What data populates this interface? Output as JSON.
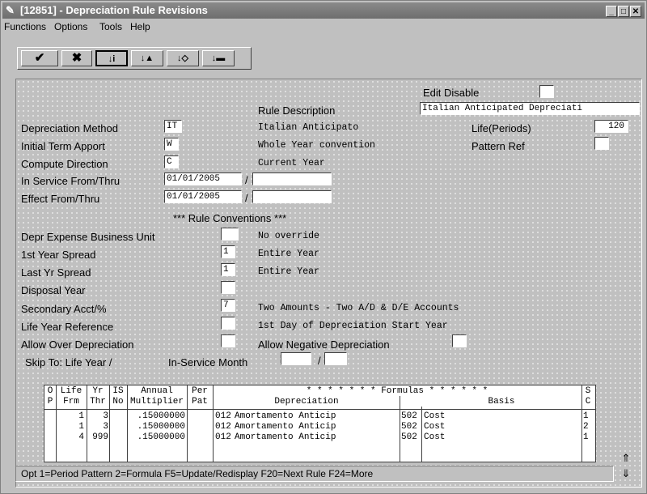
{
  "window": {
    "title": "[12851] - Depreciation Rule Revisions",
    "icon": "app-icon",
    "controls": [
      "_",
      "□",
      "✕"
    ]
  },
  "menu": [
    "Functions",
    "Options",
    "Tools",
    "Help"
  ],
  "toolbar": {
    "icons": [
      "ok-check-icon",
      "cancel-x-icon",
      "inquire-icon",
      "add-icon",
      "change-icon",
      "delete-icon"
    ]
  },
  "header": {
    "edit_disable_label": "Edit Disable",
    "edit_disable_value": "",
    "rule_description_label": "Rule Description",
    "rule_description_value": "Italian Anticipated Depreciati"
  },
  "fields": {
    "depr_method_label": "Depreciation Method",
    "depr_method_value": "IT",
    "depr_method_desc": "Italian Anticipato",
    "life_label": "Life(Periods)",
    "life_value": "120",
    "initial_term_label": "Initial Term Apport",
    "initial_term_value": "W",
    "initial_term_desc": "Whole Year convention",
    "pattern_ref_label": "Pattern Ref",
    "pattern_ref_value": "",
    "compute_dir_label": "Compute Direction",
    "compute_dir_value": "C",
    "compute_dir_desc": "Current Year",
    "in_service_label": "In Service From/Thru",
    "in_service_from": "01/01/2005",
    "in_service_thru": "",
    "effect_label": "Effect From/Thru",
    "effect_from": "01/01/2005",
    "effect_thru": "",
    "slash": "/"
  },
  "conventions": {
    "title": "*** Rule Conventions ***",
    "depr_bu_label": "Depr Expense Business Unit",
    "depr_bu_value": "",
    "depr_bu_desc": "No override",
    "first_year_label": "1st Year Spread",
    "first_year_value": "1",
    "first_year_desc": "Entire Year",
    "last_year_label": "Last Yr Spread",
    "last_year_value": "1",
    "last_year_desc": "Entire Year",
    "disposal_label": "Disposal Year",
    "disposal_value": "",
    "secondary_label": "Secondary Acct/%",
    "secondary_value": "7",
    "secondary_desc": "Two Amounts - Two A/D & D/E Accounts",
    "life_ref_label": "Life Year Reference",
    "life_ref_value": "",
    "life_ref_desc": "1st Day of Depreciation Start Year",
    "allow_over_label": "Allow Over Depreciation",
    "allow_over_value": "",
    "allow_neg_label": "Allow Negative Depreciation",
    "allow_neg_value": "",
    "skip_label": "Skip To: Life Year /",
    "in_service_month_label": "In-Service Month",
    "skip_year_value": "",
    "skip_month_value": ""
  },
  "grid": {
    "headers": {
      "op": [
        "O",
        "P"
      ],
      "life": [
        "Life",
        "Frm"
      ],
      "yr": [
        "Yr",
        "Thr"
      ],
      "is": [
        "IS",
        "No"
      ],
      "annual": [
        "Annual",
        "Multiplier"
      ],
      "per": [
        "Per",
        "Pat"
      ],
      "formulas": "* * * * * * * Formulas * * * * * *",
      "depreciation": "Depreciation",
      "basis": "Basis",
      "sc": [
        "S",
        "C"
      ]
    },
    "rows": [
      {
        "op": "",
        "life": "1",
        "yr": "3",
        "is": "",
        "annual": ".15000000",
        "per": "",
        "dep_code": "012",
        "dep_desc": "Amortamento Anticip",
        "basis_code": "502",
        "basis_desc": "Cost",
        "sc": "1"
      },
      {
        "op": "",
        "life": "1",
        "yr": "3",
        "is": "",
        "annual": ".15000000",
        "per": "",
        "dep_code": "012",
        "dep_desc": "Amortamento Anticip",
        "basis_code": "502",
        "basis_desc": "Cost",
        "sc": "2"
      },
      {
        "op": "",
        "life": "4",
        "yr": "999",
        "is": "",
        "annual": ".15000000",
        "per": "",
        "dep_code": "012",
        "dep_desc": "Amortamento Anticip",
        "basis_code": "502",
        "basis_desc": "Cost",
        "sc": "1"
      }
    ]
  },
  "status": "Opt 1=Period Pattern 2=Formula F5=Update/Redisplay F20=Next Rule F24=More",
  "scroll": {
    "up": "⇑",
    "down": "⇓"
  }
}
